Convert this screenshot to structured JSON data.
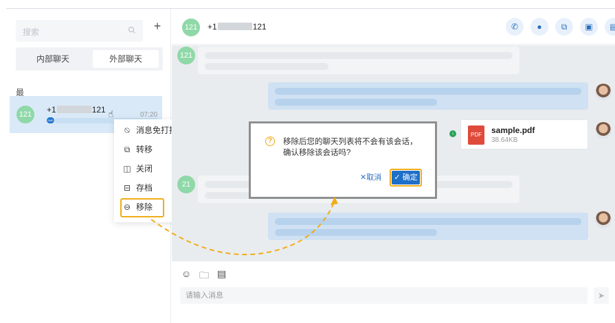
{
  "sidebar": {
    "search_placeholder": "搜索",
    "add_label": "+",
    "tabs": [
      {
        "label": "内部聊天"
      },
      {
        "label": "外部聊天"
      }
    ],
    "recent_label": "最近",
    "conversation": {
      "avatar_text": "121",
      "name_prefix": "+1",
      "name_suffix": "121",
      "time": "07:20",
      "badge": "SMS"
    }
  },
  "context_menu": {
    "items": [
      {
        "label": "消息免打扰",
        "icon": "mute-bell-icon"
      },
      {
        "label": "转移",
        "icon": "transfer-icon"
      },
      {
        "label": "关闭",
        "icon": "close-chat-icon"
      },
      {
        "label": "存档",
        "icon": "archive-icon"
      },
      {
        "label": "移除",
        "icon": "remove-circle-icon"
      }
    ]
  },
  "chat": {
    "header": {
      "avatar_text": "121",
      "title_prefix": "+1",
      "title_suffix": "121",
      "actions": [
        "phone-icon",
        "contact-icon",
        "transfer-icon",
        "note-icon",
        "archive-icon"
      ]
    },
    "messages": [
      {
        "avatar_text": "121"
      },
      {
        "avatar_text": "21"
      }
    ],
    "file": {
      "name": "sample.pdf",
      "size": "38.64KB",
      "type_label": "PDF"
    },
    "input_placeholder": "请输入消息"
  },
  "dialog": {
    "message": "移除后您的聊天列表将不会有该会话，确认移除该会话吗?",
    "cancel_label": "取消",
    "confirm_label": "确定"
  },
  "colors": {
    "accent": "#1e6fc8",
    "highlight": "#f0ac19",
    "avatar": "#8fd8a8"
  }
}
